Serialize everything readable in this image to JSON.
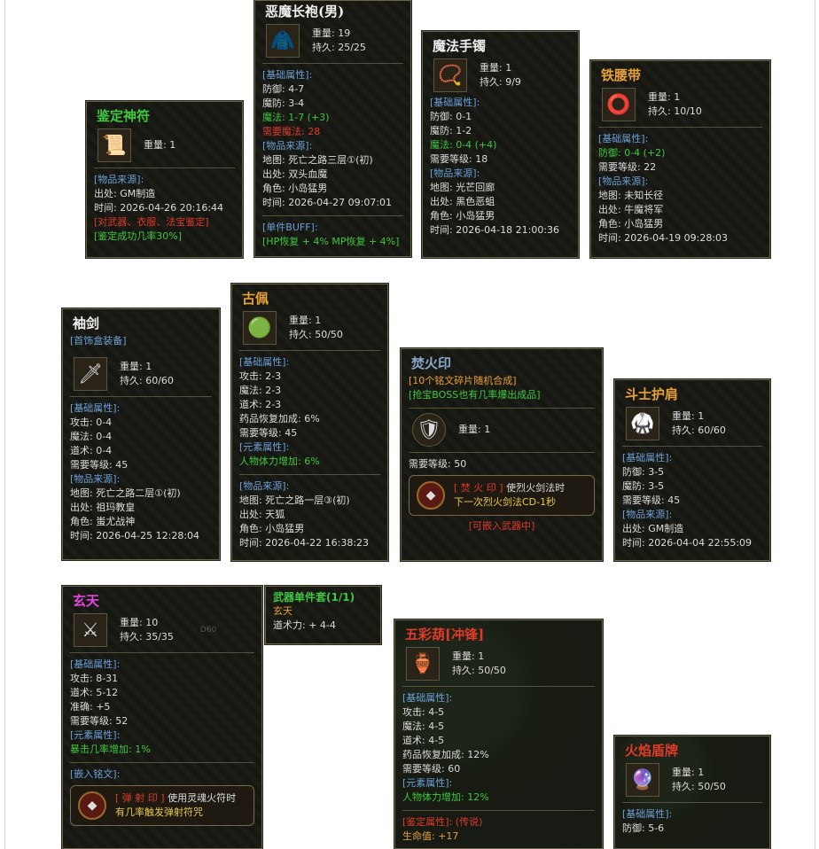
{
  "items": {
    "jianding": {
      "title": "鉴定神符",
      "weight": "重量: 1",
      "source_header": "[物品来源]:",
      "source_from": "出处: GM制造",
      "source_time": "时间: 2026-04-26 20:16:44",
      "note1": "[对武器、衣服、法宝鉴定]",
      "note2": "[鉴定成功几率30%]"
    },
    "emo": {
      "title": "恶魔长袍(男)",
      "weight": "重量: 19",
      "durability": "持久: 25/25",
      "base_header": "[基础属性]:",
      "stats": [
        "防御: 4-7",
        "魔防: 3-4"
      ],
      "magic": "魔法: 1-7 (+3)",
      "req": "需要魔法: 28",
      "source_header": "[物品来源]:",
      "map": "地图: 死亡之路三层①(初)",
      "from": "出处: 双头血魔",
      "role": "角色: 小岛猛男",
      "time": "时间: 2026-04-27 09:07:01",
      "buff_header": "[单件BUFF]:",
      "buff": "[HP恢复 + 4% MP恢复 + 4%]"
    },
    "mofa": {
      "title": "魔法手镯",
      "weight": "重量: 1",
      "durability": "持久: 9/9",
      "base_header": "[基础属性]:",
      "stats": [
        "防御: 0-1",
        "魔防: 1-2"
      ],
      "magic": "魔法: 0-4 (+4)",
      "req": "需要等级: 18",
      "source_header": "[物品来源]:",
      "map": "地图: 光芒回廊",
      "from": "出处: 黑色恶蛆",
      "role": "角色: 小岛猛男",
      "time": "时间: 2026-04-18 21:00:36"
    },
    "tieyao": {
      "title": "铁腰带",
      "weight": "重量: 1",
      "durability": "持久: 10/10",
      "base_header": "[基础属性]:",
      "defense": "防御: 0-4 (+2)",
      "req": "需要等级: 22",
      "source_header": "[物品来源]:",
      "map": "地图: 未知长径",
      "from": "出处: 牛魔将军",
      "role": "角色: 小岛猛男",
      "time": "时间: 2026-04-19 09:28:03"
    },
    "xiujian": {
      "title": "袖剑",
      "subtitle": "[首饰盒装备]",
      "weight": "重量: 1",
      "durability": "持久: 60/60",
      "base_header": "[基础属性]:",
      "stats": [
        "攻击: 0-4",
        "魔法: 0-4",
        "道术: 0-4",
        "需要等级: 45"
      ],
      "source_header": "[物品来源]:",
      "map": "地图: 死亡之路二层①(初)",
      "from": "出处: 祖玛教皇",
      "role": "角色: 蚩尤战神",
      "time": "时间: 2026-04-25 12:28:04"
    },
    "gupei": {
      "title": "古佩",
      "weight": "重量: 1",
      "durability": "持久: 50/50",
      "base_header": "[基础属性]:",
      "stats": [
        "攻击: 2-3",
        "魔法: 2-3",
        "道术: 2-3",
        "药品恢复加成: 6%",
        "需要等级: 45"
      ],
      "elem_header": "[元素属性]:",
      "elem": "人物体力增加: 6%",
      "source_header": "[物品来源]:",
      "map": "地图: 死亡之路一层③(初)",
      "from": "出处: 天狐",
      "role": "角色: 小岛猛男",
      "time": "时间: 2026-04-22 16:38:23"
    },
    "fenhuo": {
      "title": "焚火印",
      "note1": "[10个铭文碎片随机合成]",
      "note2": "[抢宝BOSS也有几率爆出成品]",
      "weight": "重量: 1",
      "req": "需要等级: 50",
      "skill_name": "[ 焚 火 印 ]",
      "skill_desc1": "使烈火剑法时",
      "skill_desc2": "下一次烈火剑法CD-1秒",
      "embed": "[可嵌入武器中]"
    },
    "doushi": {
      "title": "斗士护肩",
      "weight": "重量: 1",
      "durability": "持久: 60/60",
      "base_header": "[基础属性]:",
      "stats": [
        "防御: 3-5",
        "魔防: 3-5",
        "需要等级: 45"
      ],
      "source_header": "[物品来源]:",
      "from": "出处: GM制造",
      "time": "时间: 2026-04-04 22:55:09"
    },
    "xuantian": {
      "title": "玄天",
      "weight": "重量: 10",
      "durability": "持久: 35/35",
      "base_header": "[基础属性]:",
      "stats": [
        "攻击: 8-31",
        "道术: 5-12",
        "准确: +5",
        "需要等级: 52"
      ],
      "elem_header": "[元素属性]:",
      "elem": "暴击几率增加: 1%",
      "inscr_header": "[嵌入铭文]:",
      "skill_name": "[ 弹 射 印 ]",
      "skill_desc1": "使用灵魂火符时",
      "skill_desc2": "有几率触发弹射符咒",
      "bg_text": "D60"
    },
    "taozhuang": {
      "title": "武器单件套(1/1)",
      "name": "玄天",
      "stat": "道术力: + 4-4"
    },
    "wucai": {
      "title": "五彩葫[冲锋]",
      "weight": "重量: 1",
      "durability": "持久: 50/50",
      "base_header": "[基础属性]:",
      "stats": [
        "攻击: 4-5",
        "魔法: 4-5",
        "道术: 4-5",
        "药品恢复加成: 12%",
        "需要等级: 60"
      ],
      "elem_header": "[元素属性]:",
      "elem": "人物体力增加: 12%",
      "ident_header": "[鉴定属性]: (传说)",
      "ident": "生命值: +17"
    },
    "huoyan": {
      "title": "火焰盾牌",
      "weight": "重量: 1",
      "durability": "持久: 50/50",
      "base_header": "[基础属性]:",
      "stat": "防御: 5-6"
    }
  },
  "colors": {
    "green_title": "#3ec83e",
    "orange_title": "#e8a038",
    "white_title": "#f0f0f0",
    "magenta_title": "#e048e0",
    "red_title": "#e03a2a"
  }
}
